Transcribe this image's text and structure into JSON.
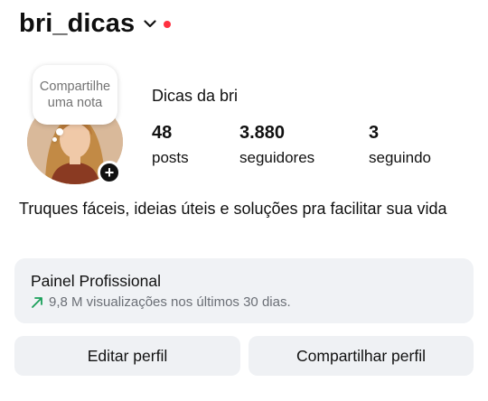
{
  "header": {
    "username": "bri_dicas",
    "dropdown_icon": "chevron-down-icon",
    "notification_color": "#ff3040"
  },
  "profile": {
    "note": "Compartilhe uma nota",
    "display_name": "Dicas da bri",
    "stats": [
      {
        "value": "48",
        "label": "posts"
      },
      {
        "value": "3.880",
        "label": "seguidores"
      },
      {
        "value": "3",
        "label": "seguindo"
      }
    ],
    "bio": "Truques fáceis, ideias úteis e soluções pra facilitar sua vida"
  },
  "professional_panel": {
    "title": "Painel Profissional",
    "subtitle": "9,8 M visualizações nos últimos 30 dias.",
    "trend_color": "#1aa05a"
  },
  "actions": {
    "edit": "Editar perfil",
    "share": "Compartilhar perfil"
  }
}
